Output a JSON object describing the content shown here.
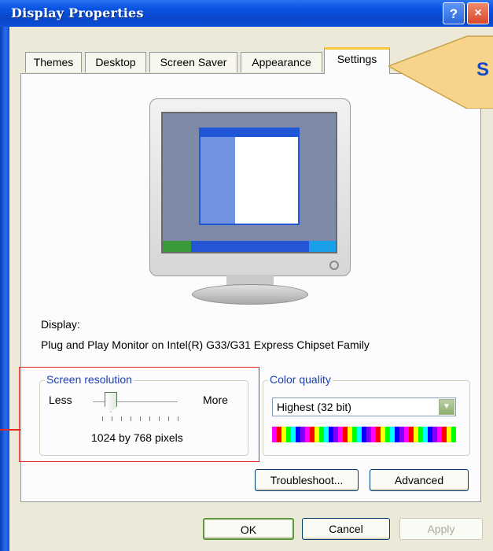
{
  "window": {
    "title": "Display Properties",
    "help_glyph": "?",
    "close_glyph": "×"
  },
  "tabs": [
    {
      "label": "Themes"
    },
    {
      "label": "Desktop"
    },
    {
      "label": "Screen Saver"
    },
    {
      "label": "Appearance"
    },
    {
      "label": "Settings",
      "active": true
    }
  ],
  "display": {
    "label": "Display:",
    "monitor": "Plug and Play Monitor on Intel(R) G33/G31 Express Chipset Family"
  },
  "resolution": {
    "group_label": "Screen resolution",
    "less_label": "Less",
    "more_label": "More",
    "value_text": "1024 by 768 pixels"
  },
  "color_quality": {
    "group_label": "Color quality",
    "selected": "Highest (32 bit)"
  },
  "buttons": {
    "troubleshoot": "Troubleshoot...",
    "advanced": "Advanced",
    "ok": "OK",
    "cancel": "Cancel",
    "apply": "Apply"
  },
  "callout": {
    "text": "S"
  },
  "colors": {
    "accent": "#1446c7",
    "highlight_box": "#e32a1a",
    "titlebar": "#0b4fd8"
  }
}
